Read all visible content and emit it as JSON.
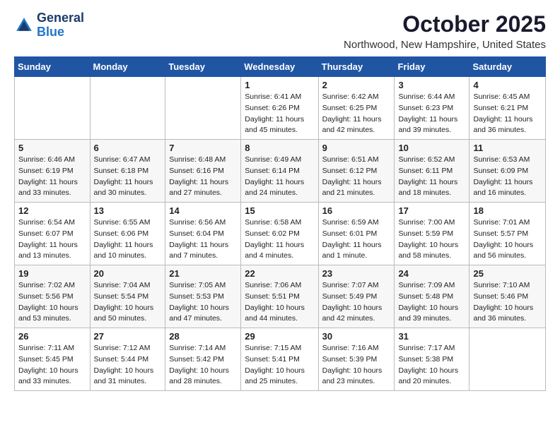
{
  "header": {
    "logo_line1": "General",
    "logo_line2": "Blue",
    "month_title": "October 2025",
    "location": "Northwood, New Hampshire, United States"
  },
  "weekdays": [
    "Sunday",
    "Monday",
    "Tuesday",
    "Wednesday",
    "Thursday",
    "Friday",
    "Saturday"
  ],
  "weeks": [
    [
      {
        "day": "",
        "info": ""
      },
      {
        "day": "",
        "info": ""
      },
      {
        "day": "",
        "info": ""
      },
      {
        "day": "1",
        "info": "Sunrise: 6:41 AM\nSunset: 6:26 PM\nDaylight: 11 hours\nand 45 minutes."
      },
      {
        "day": "2",
        "info": "Sunrise: 6:42 AM\nSunset: 6:25 PM\nDaylight: 11 hours\nand 42 minutes."
      },
      {
        "day": "3",
        "info": "Sunrise: 6:44 AM\nSunset: 6:23 PM\nDaylight: 11 hours\nand 39 minutes."
      },
      {
        "day": "4",
        "info": "Sunrise: 6:45 AM\nSunset: 6:21 PM\nDaylight: 11 hours\nand 36 minutes."
      }
    ],
    [
      {
        "day": "5",
        "info": "Sunrise: 6:46 AM\nSunset: 6:19 PM\nDaylight: 11 hours\nand 33 minutes."
      },
      {
        "day": "6",
        "info": "Sunrise: 6:47 AM\nSunset: 6:18 PM\nDaylight: 11 hours\nand 30 minutes."
      },
      {
        "day": "7",
        "info": "Sunrise: 6:48 AM\nSunset: 6:16 PM\nDaylight: 11 hours\nand 27 minutes."
      },
      {
        "day": "8",
        "info": "Sunrise: 6:49 AM\nSunset: 6:14 PM\nDaylight: 11 hours\nand 24 minutes."
      },
      {
        "day": "9",
        "info": "Sunrise: 6:51 AM\nSunset: 6:12 PM\nDaylight: 11 hours\nand 21 minutes."
      },
      {
        "day": "10",
        "info": "Sunrise: 6:52 AM\nSunset: 6:11 PM\nDaylight: 11 hours\nand 18 minutes."
      },
      {
        "day": "11",
        "info": "Sunrise: 6:53 AM\nSunset: 6:09 PM\nDaylight: 11 hours\nand 16 minutes."
      }
    ],
    [
      {
        "day": "12",
        "info": "Sunrise: 6:54 AM\nSunset: 6:07 PM\nDaylight: 11 hours\nand 13 minutes."
      },
      {
        "day": "13",
        "info": "Sunrise: 6:55 AM\nSunset: 6:06 PM\nDaylight: 11 hours\nand 10 minutes."
      },
      {
        "day": "14",
        "info": "Sunrise: 6:56 AM\nSunset: 6:04 PM\nDaylight: 11 hours\nand 7 minutes."
      },
      {
        "day": "15",
        "info": "Sunrise: 6:58 AM\nSunset: 6:02 PM\nDaylight: 11 hours\nand 4 minutes."
      },
      {
        "day": "16",
        "info": "Sunrise: 6:59 AM\nSunset: 6:01 PM\nDaylight: 11 hours\nand 1 minute."
      },
      {
        "day": "17",
        "info": "Sunrise: 7:00 AM\nSunset: 5:59 PM\nDaylight: 10 hours\nand 58 minutes."
      },
      {
        "day": "18",
        "info": "Sunrise: 7:01 AM\nSunset: 5:57 PM\nDaylight: 10 hours\nand 56 minutes."
      }
    ],
    [
      {
        "day": "19",
        "info": "Sunrise: 7:02 AM\nSunset: 5:56 PM\nDaylight: 10 hours\nand 53 minutes."
      },
      {
        "day": "20",
        "info": "Sunrise: 7:04 AM\nSunset: 5:54 PM\nDaylight: 10 hours\nand 50 minutes."
      },
      {
        "day": "21",
        "info": "Sunrise: 7:05 AM\nSunset: 5:53 PM\nDaylight: 10 hours\nand 47 minutes."
      },
      {
        "day": "22",
        "info": "Sunrise: 7:06 AM\nSunset: 5:51 PM\nDaylight: 10 hours\nand 44 minutes."
      },
      {
        "day": "23",
        "info": "Sunrise: 7:07 AM\nSunset: 5:49 PM\nDaylight: 10 hours\nand 42 minutes."
      },
      {
        "day": "24",
        "info": "Sunrise: 7:09 AM\nSunset: 5:48 PM\nDaylight: 10 hours\nand 39 minutes."
      },
      {
        "day": "25",
        "info": "Sunrise: 7:10 AM\nSunset: 5:46 PM\nDaylight: 10 hours\nand 36 minutes."
      }
    ],
    [
      {
        "day": "26",
        "info": "Sunrise: 7:11 AM\nSunset: 5:45 PM\nDaylight: 10 hours\nand 33 minutes."
      },
      {
        "day": "27",
        "info": "Sunrise: 7:12 AM\nSunset: 5:44 PM\nDaylight: 10 hours\nand 31 minutes."
      },
      {
        "day": "28",
        "info": "Sunrise: 7:14 AM\nSunset: 5:42 PM\nDaylight: 10 hours\nand 28 minutes."
      },
      {
        "day": "29",
        "info": "Sunrise: 7:15 AM\nSunset: 5:41 PM\nDaylight: 10 hours\nand 25 minutes."
      },
      {
        "day": "30",
        "info": "Sunrise: 7:16 AM\nSunset: 5:39 PM\nDaylight: 10 hours\nand 23 minutes."
      },
      {
        "day": "31",
        "info": "Sunrise: 7:17 AM\nSunset: 5:38 PM\nDaylight: 10 hours\nand 20 minutes."
      },
      {
        "day": "",
        "info": ""
      }
    ]
  ]
}
